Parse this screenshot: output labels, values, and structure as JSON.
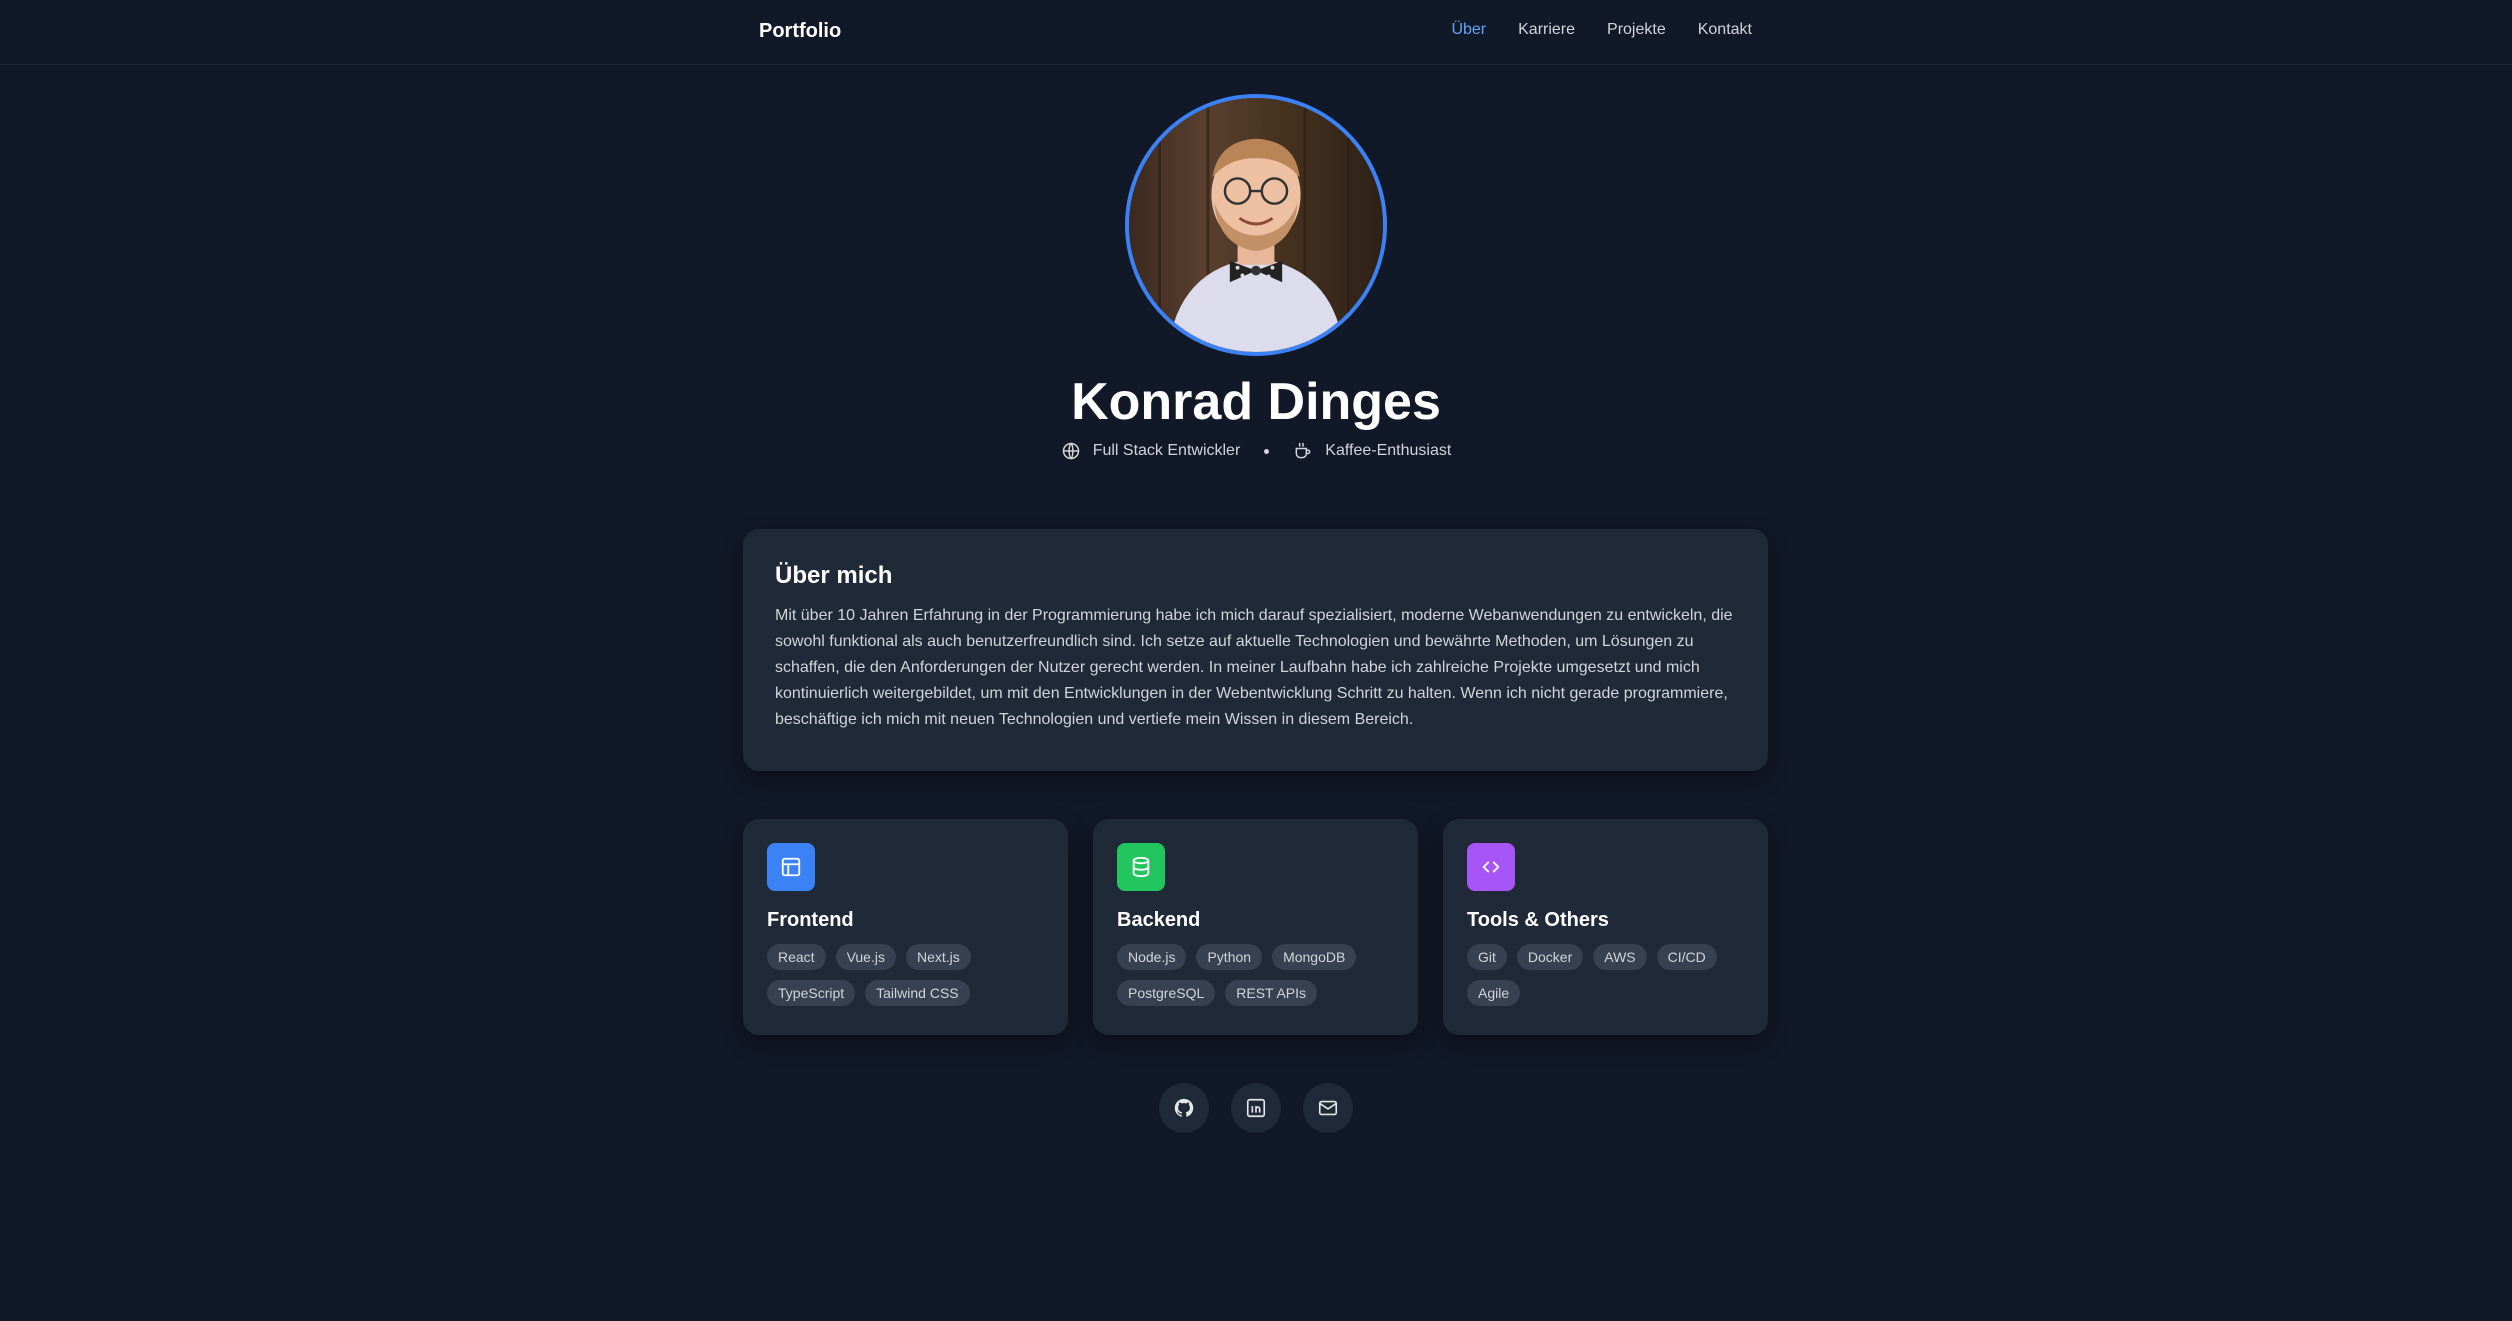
{
  "nav": {
    "brand": "Portfolio",
    "links": [
      {
        "label": "Über",
        "active": true
      },
      {
        "label": "Karriere",
        "active": false
      },
      {
        "label": "Projekte",
        "active": false
      },
      {
        "label": "Kontakt",
        "active": false
      }
    ]
  },
  "profile": {
    "name": "Konrad Dinges",
    "role": "Full Stack Entwickler",
    "hobby": "Kaffee-Enthusiast",
    "role_icon": "globe-icon",
    "hobby_icon": "coffee-icon"
  },
  "about": {
    "title": "Über mich",
    "text": "Mit über 10 Jahren Erfahrung in der Programmierung habe ich mich darauf spezialisiert, moderne Webanwendungen zu entwickeln, die sowohl funktional als auch benutzerfreundlich sind. Ich setze auf aktuelle Technologien und bewährte Methoden, um Lösungen zu schaffen, die den Anforderungen der Nutzer gerecht werden. In meiner Laufbahn habe ich zahlreiche Projekte umgesetzt und mich kontinuierlich weitergebildet, um mit den Entwicklungen in der Webentwicklung Schritt zu halten. Wenn ich nicht gerade programmiere, beschäftige ich mich mit neuen Technologien und vertiefe mein Wissen in diesem Bereich."
  },
  "skills": [
    {
      "title": "Frontend",
      "icon": "layout-icon",
      "color": "#3b82f6",
      "tags": [
        "React",
        "Vue.js",
        "Next.js",
        "TypeScript",
        "Tailwind CSS"
      ]
    },
    {
      "title": "Backend",
      "icon": "database-icon",
      "color": "#22c55e",
      "tags": [
        "Node.js",
        "Python",
        "MongoDB",
        "PostgreSQL",
        "REST APIs"
      ]
    },
    {
      "title": "Tools & Others",
      "icon": "code-icon",
      "color": "#a855f7",
      "tags": [
        "Git",
        "Docker",
        "AWS",
        "CI/CD",
        "Agile"
      ]
    }
  ],
  "socials": [
    {
      "icon": "github-icon"
    },
    {
      "icon": "linkedin-icon"
    },
    {
      "icon": "mail-icon"
    }
  ],
  "colors": {
    "background": "#111827",
    "card": "#1f2937",
    "accent": "#3b82f6",
    "active_link": "#60a5fa",
    "tag_bg": "#374151"
  }
}
